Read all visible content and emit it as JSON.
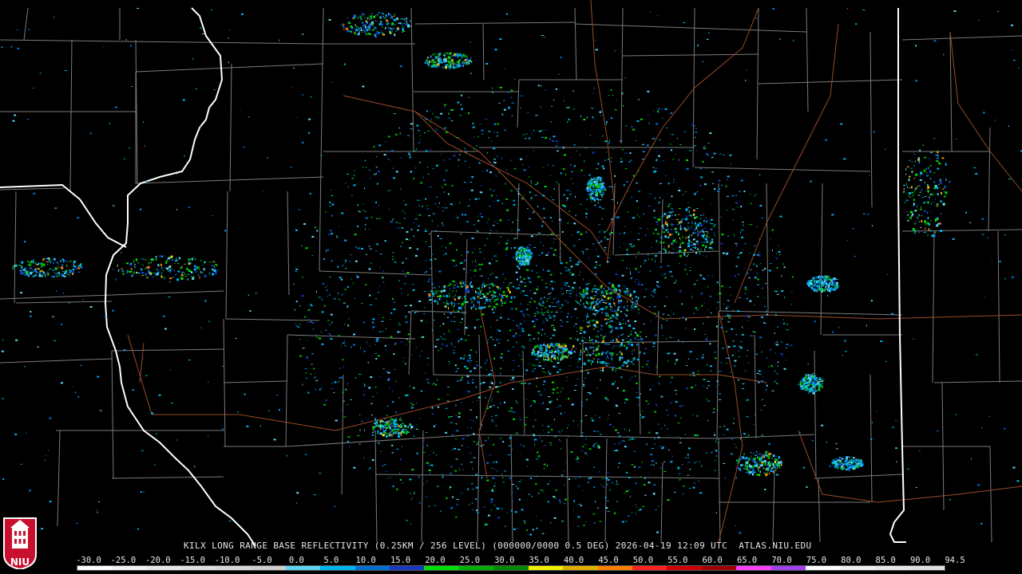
{
  "product": {
    "caption": "KILX LONG RANGE BASE REFLECTIVITY (0.25KM / 256 LEVEL) (000000/0000 0.5 DEG) 2026-04-19 12:09 UTC  ATLAS.NIU.EDU",
    "logo_text": "NIU"
  },
  "scale": {
    "labels": [
      "-30.0",
      "-25.0",
      "-20.0",
      "-15.0",
      "-10.0",
      "-5.0",
      "0.0",
      "5.0",
      "10.0",
      "15.0",
      "20.0",
      "25.0",
      "30.0",
      "35.0",
      "40.0",
      "45.0",
      "50.0",
      "55.0",
      "60.0",
      "65.0",
      "70.0",
      "75.0",
      "80.0",
      "85.0",
      "90.0",
      "94.5"
    ],
    "colors": [
      "#ffffff",
      "#f2f2f2",
      "#e8e8e8",
      "#e0e0e0",
      "#d8d8d8",
      "#cfcfcf",
      "#5fd5f2",
      "#00b4f0",
      "#0070d8",
      "#1838c0",
      "#00e000",
      "#00b000",
      "#008800",
      "#f0f000",
      "#e0b000",
      "#ff8000",
      "#ff2020",
      "#d00000",
      "#a00000",
      "#ff40ff",
      "#a040f0",
      "#ffffff",
      "#f0f0f0",
      "#e8e8e8",
      "#e0e0e0"
    ]
  },
  "colors": {
    "background": "#000000",
    "county_lines": "#7a7a7a",
    "state_lines": "#ffffff",
    "highways": "#9a4a2a"
  }
}
